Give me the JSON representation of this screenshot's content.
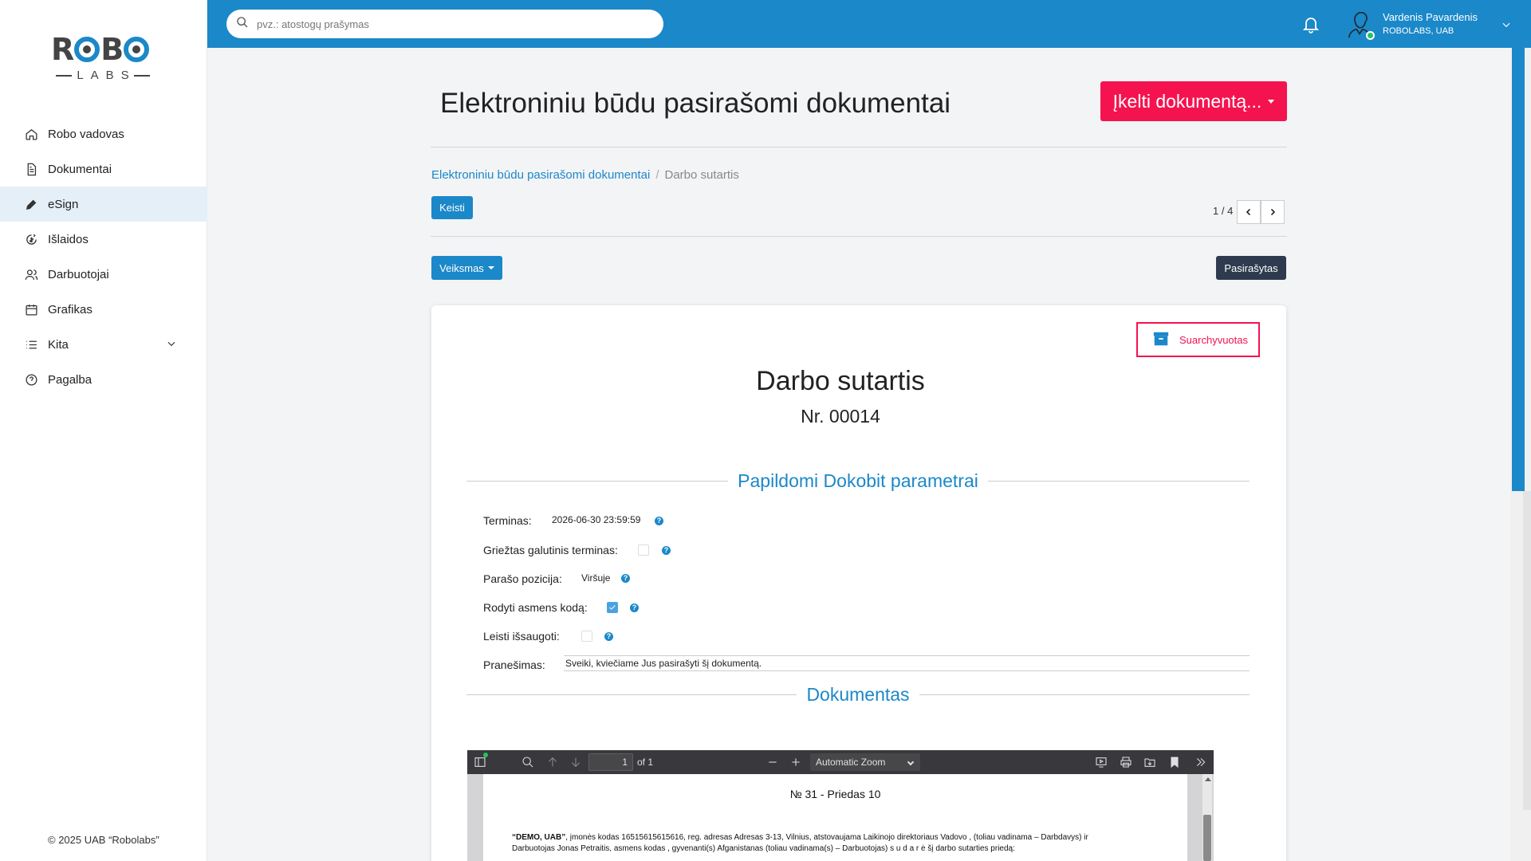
{
  "sidebar": {
    "logo": {
      "top": "ROBO",
      "bottom": "LABS"
    },
    "items": [
      {
        "label": "Robo vadovas",
        "icon": "home-icon"
      },
      {
        "label": "Dokumentai",
        "icon": "document-icon"
      },
      {
        "label": "eSign",
        "icon": "pen-icon",
        "active": true
      },
      {
        "label": "Išlaidos",
        "icon": "expenses-icon"
      },
      {
        "label": "Darbuotojai",
        "icon": "users-icon"
      },
      {
        "label": "Grafikas",
        "icon": "calendar-icon"
      },
      {
        "label": "Kita",
        "icon": "list-icon",
        "expandable": true
      },
      {
        "label": "Pagalba",
        "icon": "help-circle-icon"
      }
    ],
    "copyright": "© 2025 UAB “Robolabs”"
  },
  "topbar": {
    "search_placeholder": "pvz.: atostogų prašymas",
    "user_name": "Vardenis Pavardenis",
    "user_company": "ROBOLABS, UAB"
  },
  "main": {
    "title": "Elektroniniu būdu pasirašomi dokumentai",
    "upload_label": "Įkelti dokumentą...",
    "breadcrumb": {
      "link": "Elektroniniu būdu pasirašomi dokumentai",
      "separator": "/",
      "current": "Darbo sutartis"
    },
    "edit_label": "Keisti",
    "pager": "1 / 4",
    "action_label": "Veiksmas",
    "status": "Pasirašytas"
  },
  "document": {
    "archived_label": "Suarchyvuotas",
    "title": "Darbo sutartis",
    "number": "Nr. 00014",
    "params_heading": "Papildomi Dokobit parametrai",
    "fields": {
      "deadline_label": "Terminas:",
      "deadline_value": "2026-06-30 23:59:59",
      "strict_deadline_label": "Griežtas galutinis terminas:",
      "strict_deadline_checked": false,
      "signature_position_label": "Parašo pozicija:",
      "signature_position_value": "Viršuje",
      "show_personal_code_label": "Rodyti asmens kodą:",
      "show_personal_code_checked": true,
      "allow_save_label": "Leisti išsaugoti:",
      "allow_save_checked": false,
      "message_label": "Pranešimas:",
      "message_value": "Sveiki, kviečiame Jus pasirašyti šį dokumentą."
    },
    "doc_heading": "Dokumentas",
    "help_glyph": "?"
  },
  "pdf_viewer": {
    "page_value": "1",
    "page_total": "of 1",
    "zoom": "Automatic Zoom",
    "page_heading": "№ 31 - Priedas 10",
    "para_company": "“DEMO, UAB”",
    "para_line1": ", įmonės kodas 16515615615616, reg. adresas Adresas 3-13, Vilnius, atstovaujama Laikinojo direktoriaus Vadovo , (toliau vadinama – Darbdavys) ir",
    "para_line2": "Darbuotojas Jonas Petraitis, asmens kodas , gyvenanti(s) Afganistanas (toliau vadinama(s) – Darbuotojas) s u d a r ė šį darbo sutarties priedą:"
  },
  "colors": {
    "brand_blue": "#1b88c9",
    "accent_red": "#f5134f",
    "dark_badge": "#2e3a4e",
    "pdf_toolbar": "#38383d"
  }
}
